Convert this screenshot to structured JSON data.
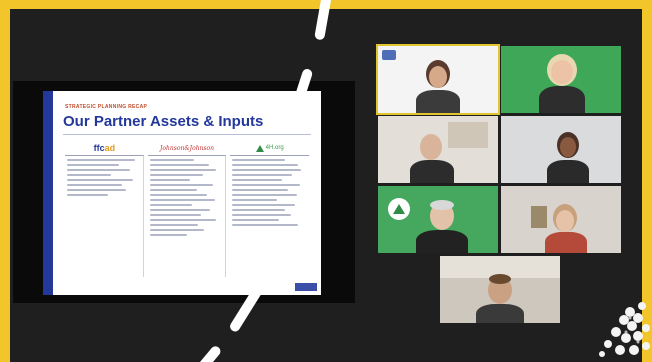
{
  "meeting": {
    "shared_slide": {
      "kicker": "STRATEGIC PLANNING RECAP",
      "title": "Our Partner Assets & Inputs",
      "columns": [
        {
          "logo_a": "ffc",
          "logo_b": "ad"
        },
        {
          "logo": "Johnson&Johnson"
        },
        {
          "logo": "4H.org"
        }
      ]
    },
    "participants": [
      {
        "id": "t1",
        "caption": ""
      },
      {
        "id": "t2",
        "caption": ""
      },
      {
        "id": "t3",
        "caption": ""
      },
      {
        "id": "t4",
        "caption": ""
      },
      {
        "id": "t5",
        "caption": ""
      },
      {
        "id": "t6",
        "caption": ""
      },
      {
        "id": "t7",
        "caption": ""
      }
    ]
  },
  "colors": {
    "frame": "#f2c62a",
    "stage": "#1f1f1f",
    "slide_accent": "#23389a",
    "green_bg": "#3fa758"
  },
  "icons": [
    "4h-clover-logo",
    "partner-logo"
  ]
}
